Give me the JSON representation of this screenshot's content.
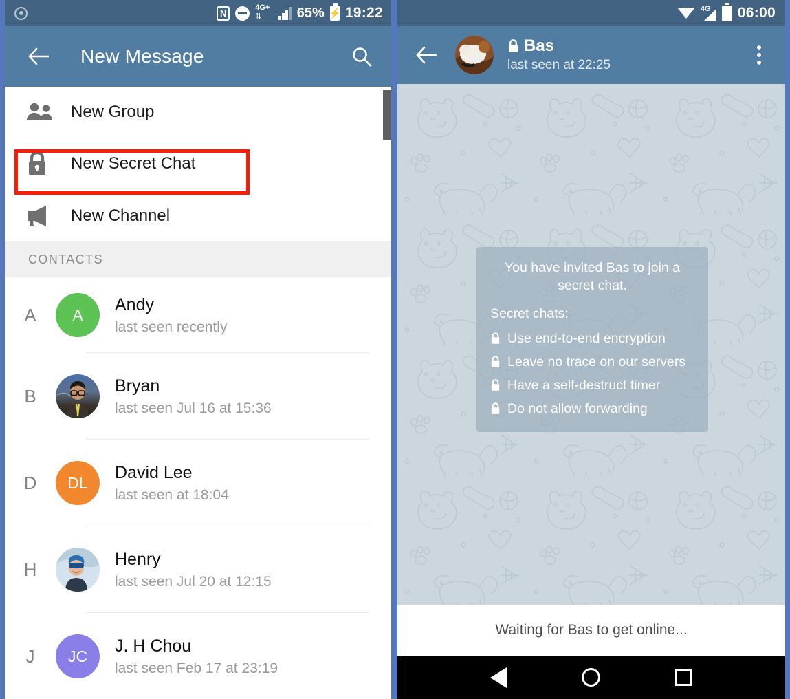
{
  "left_phone": {
    "status_bar": {
      "cast_icon": "screen-cast-icon",
      "nfc_icon": "nfc-icon",
      "nfc_label": "N",
      "dnd_icon": "do-not-disturb-icon",
      "network_label": "4G+",
      "network_arrows": "⇅",
      "signal_icon": "signal-bars-icon",
      "battery_percent": "65%",
      "battery_icon": "battery-charging-icon",
      "time": "19:22"
    },
    "toolbar": {
      "back_icon": "back-arrow-icon",
      "title": "New Message",
      "search_icon": "search-icon"
    },
    "menu": [
      {
        "icon": "group-people-icon",
        "label": "New Group",
        "highlighted": false
      },
      {
        "icon": "lock-icon",
        "label": "New Secret Chat",
        "highlighted": true
      },
      {
        "icon": "megaphone-icon",
        "label": "New Channel",
        "highlighted": false
      }
    ],
    "contacts_header": "CONTACTS",
    "contacts": [
      {
        "letter": "A",
        "name": "Andy",
        "status": "last seen recently",
        "avatar_type": "initials",
        "initials": "A",
        "color": "#5cc254"
      },
      {
        "letter": "B",
        "name": "Bryan",
        "status": "last seen Jul 16 at 15:36",
        "avatar_type": "photo",
        "initials": "",
        "color": "#47618a"
      },
      {
        "letter": "D",
        "name": "David Lee",
        "status": "last seen at 18:04",
        "avatar_type": "initials",
        "initials": "DL",
        "color": "#f2882d"
      },
      {
        "letter": "H",
        "name": "Henry",
        "status": "last seen Jul 20 at 12:15",
        "avatar_type": "photo",
        "initials": "",
        "color": "#7fa7c9"
      },
      {
        "letter": "J",
        "name": "J. H Chou",
        "status": "last seen Feb 17 at 23:19",
        "avatar_type": "initials",
        "initials": "JC",
        "color": "#8a7ee8"
      }
    ],
    "highlight_color": "#f91c06"
  },
  "right_phone": {
    "status_bar": {
      "wifi_icon": "wifi-icon",
      "network_label": "4G",
      "signal_icon": "signal-triangle-icon",
      "battery_icon": "battery-icon",
      "time": "06:00"
    },
    "chat_header": {
      "back_icon": "back-arrow-icon",
      "avatar": "contact-avatar-photo",
      "lock_icon": "lock-icon",
      "title": "Bas",
      "subtitle": "last seen at 22:25",
      "menu_icon": "overflow-menu-icon"
    },
    "info_card": {
      "lead": "You have invited Bas to join a secret chat.",
      "heading": "Secret chats:",
      "items": [
        "Use end-to-end encryption",
        "Leave no trace on our servers",
        "Have a self-destruct timer",
        "Do not allow forwarding"
      ],
      "item_icon": "lock-icon"
    },
    "waiting_text": "Waiting for Bas to get online...",
    "nav_bar": {
      "back_icon": "nav-back-triangle-icon",
      "home_icon": "nav-home-circle-icon",
      "recents_icon": "nav-recents-square-icon"
    }
  },
  "theme": {
    "toolbar_blue": "#527da3",
    "statusbar_blue": "#426382",
    "frame_blue": "#5578bd",
    "chat_bg": "#ccd6dd"
  }
}
